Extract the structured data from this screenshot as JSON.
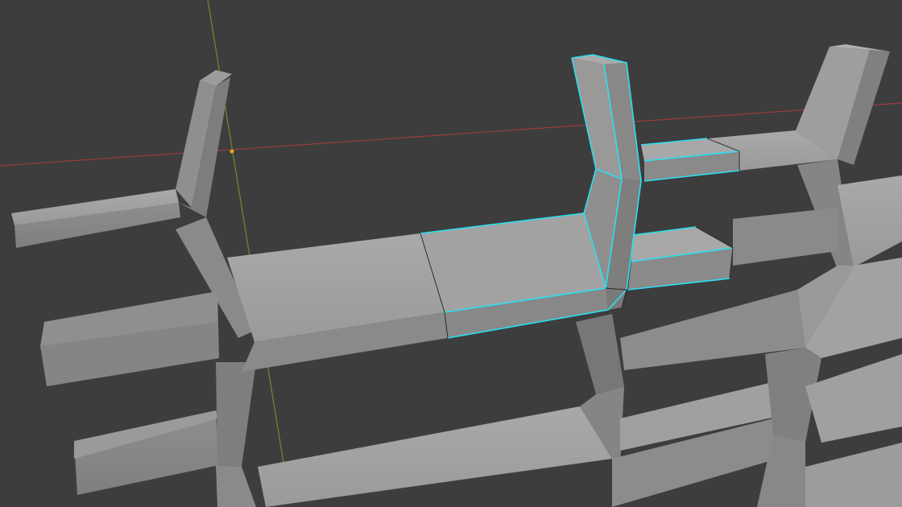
{
  "viewport": {
    "background_color": "#3d3d3d",
    "axis_x_color": "#9a3d3d",
    "axis_y_color": "#6a8f2a",
    "origin_color": "#f0a030"
  },
  "mesh": {
    "face_light_color": "#a4a4a4",
    "face_mid_color": "#8c8c8c",
    "face_dark_color": "#777777",
    "selected_edge_color": "#2be0f0",
    "edge_color": "#222222"
  }
}
